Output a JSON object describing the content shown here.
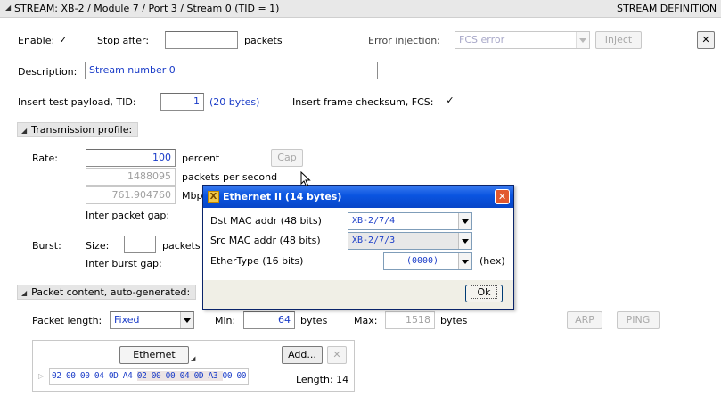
{
  "header": {
    "title": "STREAM: XB-2 / Module 7 / Port 3 / Stream   0  (TID = 1)",
    "right_label": "STREAM DEFINITION"
  },
  "row1": {
    "enable_label": "Enable:",
    "enable_checked": true,
    "stop_after_label": "Stop after:",
    "stop_after_value": "",
    "packets_label": "packets",
    "error_injection_label": "Error injection:",
    "error_injection_value": "FCS error",
    "inject_button": "Inject",
    "close_button": "✕"
  },
  "description": {
    "label": "Description:",
    "value": "Stream number 0"
  },
  "payload": {
    "label": "Insert test payload, TID:",
    "tid_value": "1",
    "bytes_note": "(20 bytes)",
    "fcs_label": "Insert frame checksum, FCS:",
    "fcs_checked": true
  },
  "transmission": {
    "section_label": "Transmission profile:",
    "rate_label": "Rate:",
    "percent_value": "100",
    "percent_unit": "percent",
    "cap_button": "Cap",
    "pps_value": "1488095",
    "pps_unit": "packets per second",
    "mbps_value": "761.904760",
    "mbps_unit": "Mbps",
    "ipg_label": "Inter packet gap:",
    "burst_label": "Burst:",
    "size_label": "Size:",
    "size_value": "",
    "burst_packets_label": "packets",
    "ibg_label": "Inter burst gap:"
  },
  "packet_content": {
    "section_label": "Packet content, auto-generated:",
    "length_label": "Packet length:",
    "length_mode": "Fixed",
    "min_label": "Min:",
    "min_value": "64",
    "min_unit": "bytes",
    "max_label": "Max:",
    "max_value": "1518",
    "max_unit": "bytes",
    "arp_button": "ARP",
    "ping_button": "PING",
    "header_button": "Ethernet",
    "add_button": "Add...",
    "remove_button": "✕",
    "hex_part1": "02 00 00 04 0D A4 ",
    "hex_part2": "02 00 00 04 0D A3 ",
    "hex_part3": "00 00",
    "length_text": "Length: 14"
  },
  "dialog": {
    "title": "Ethernet II  (14 bytes)",
    "dst_label": "Dst MAC addr  (48 bits)",
    "dst_value": "XB-2/7/4",
    "src_label": "Src MAC addr  (48 bits)",
    "src_value": "XB-2/7/3",
    "ethertype_label": "EtherType  (16 bits)",
    "ethertype_value": "(0000)",
    "hex_label": "(hex)",
    "ok_button": "Ok"
  },
  "icons": [
    "collapse-triangle-icon",
    "dropdown-arrow-icon",
    "close-icon",
    "dialog-app-icon",
    "mouse-cursor-icon",
    "expand-triangle-icon"
  ],
  "colors": {
    "value_blue": "#1a3cc8",
    "title_bar_blue": "#0a54e0",
    "header_gray": "#e6e6e6",
    "dialog_close_red": "#e2582e"
  }
}
